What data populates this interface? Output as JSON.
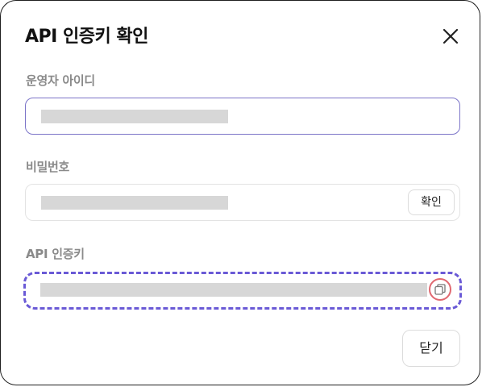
{
  "dialog": {
    "title": "API 인증키 확인",
    "close_icon": "close-icon"
  },
  "fields": {
    "username": {
      "label": "운영자 아이디",
      "value_state": "masked"
    },
    "password": {
      "label": "비밀번호",
      "value_state": "masked",
      "confirm_label": "확인"
    },
    "api_key": {
      "label": "API 인증키",
      "value_state": "masked",
      "copy_icon": "copy-icon"
    }
  },
  "footer": {
    "close_label": "닫기"
  },
  "colors": {
    "focus_border": "#7b74c8",
    "dashed_highlight": "#6a5ad6",
    "copy_highlight": "#e06870",
    "mask_fill": "#d7d7d7",
    "label_text": "#8a8a8a"
  }
}
